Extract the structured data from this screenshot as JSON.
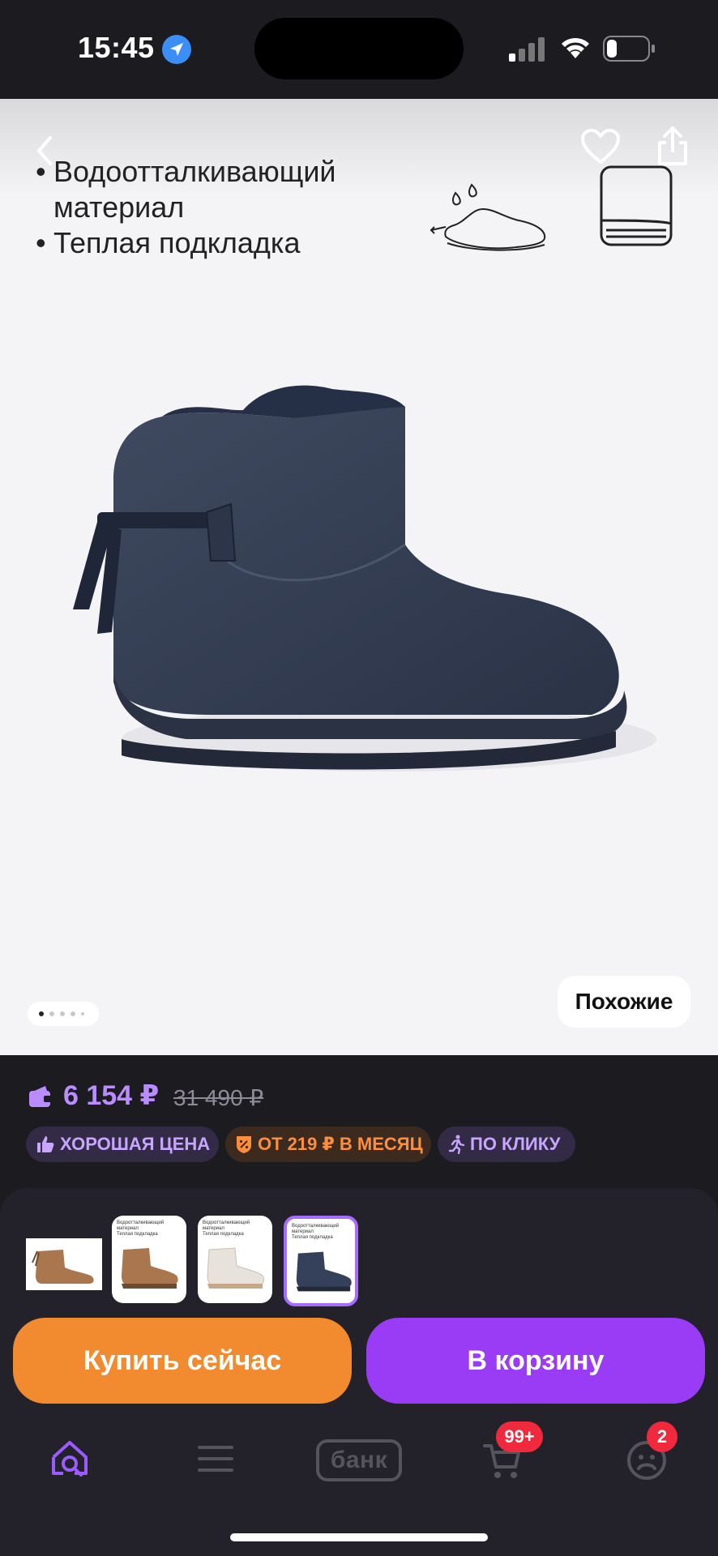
{
  "status_bar": {
    "time": "15:45",
    "battery_level": 0.25
  },
  "product": {
    "features": [
      {
        "bullet": "•",
        "text": "Водоотталкивающий материал"
      },
      {
        "bullet": "•",
        "text": "Теплая подкладка"
      }
    ],
    "gallery": {
      "total_images": 5,
      "active_index": 0,
      "similar_label": "Похожие"
    },
    "price": {
      "current": "6 154 ₽",
      "old": "31 490 ₽",
      "accent_color": "#b98cff"
    },
    "badges": {
      "good_price": "ХОРОШАЯ ЦЕНА",
      "installment": "ОТ 219 ₽ В МЕСЯЦ",
      "one_click": "ПО КЛИКУ"
    },
    "variants": {
      "count": 4,
      "selected_index": 3,
      "thumb_caption_line1": "Водоотталкивающий",
      "thumb_caption_line2": "материал",
      "thumb_caption_line3": "Теплая подкладка"
    }
  },
  "actions": {
    "buy_now": "Купить сейчас",
    "add_to_cart": "В корзину",
    "buy_now_color": "#f28a30",
    "add_to_cart_color": "#9a3cf5"
  },
  "tabbar": {
    "items": [
      {
        "icon": "home-search-icon",
        "active": true
      },
      {
        "icon": "catalog-icon",
        "active": false
      },
      {
        "icon": "bank-icon",
        "label": "банк",
        "active": false
      },
      {
        "icon": "cart-icon",
        "badge": "99+",
        "active": false
      },
      {
        "icon": "profile-icon",
        "badge": "2",
        "active": false
      }
    ]
  }
}
